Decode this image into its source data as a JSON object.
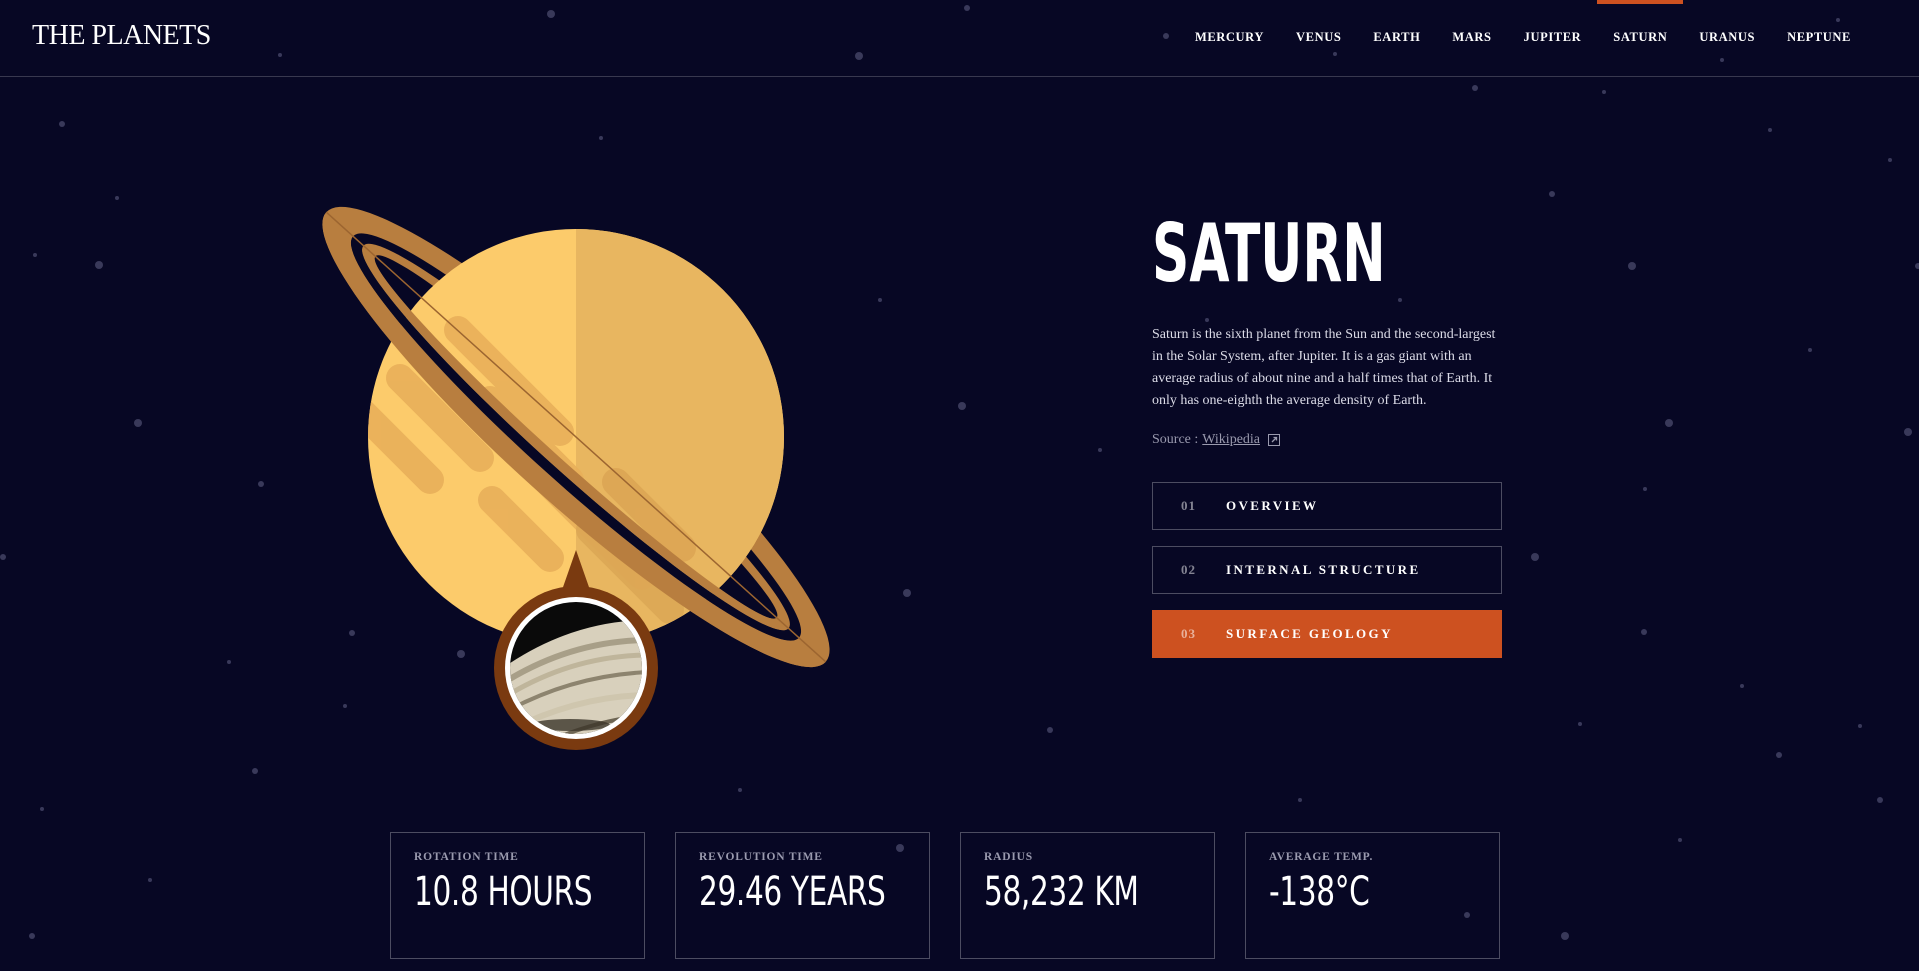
{
  "header": {
    "logo": "THE PLANETS",
    "nav": [
      {
        "label": "MERCURY",
        "active": false
      },
      {
        "label": "VENUS",
        "active": false
      },
      {
        "label": "EARTH",
        "active": false
      },
      {
        "label": "MARS",
        "active": false
      },
      {
        "label": "JUPITER",
        "active": false
      },
      {
        "label": "SATURN",
        "active": true
      },
      {
        "label": "URANUS",
        "active": false
      },
      {
        "label": "NEPTUNE",
        "active": false
      }
    ]
  },
  "planet": {
    "name": "SATURN",
    "description": "Saturn is the sixth planet from the Sun and the second-largest in the Solar System, after Jupiter. It is a gas giant with an average radius of about nine and a half times that of Earth. It only has one-eighth the average density of Earth.",
    "source_label": "Source :",
    "source_link": "Wikipedia",
    "image_icon": "saturn-illustration",
    "geology_icon": "saturn-surface-geology-thumbnail"
  },
  "tabs": [
    {
      "num": "01",
      "label": "OVERVIEW",
      "active": false
    },
    {
      "num": "02",
      "label": "INTERNAL STRUCTURE",
      "active": false
    },
    {
      "num": "03",
      "label": "SURFACE GEOLOGY",
      "active": true
    }
  ],
  "stats": [
    {
      "label": "ROTATION TIME",
      "value": "10.8 HOURS"
    },
    {
      "label": "REVOLUTION TIME",
      "value": "29.46 YEARS"
    },
    {
      "label": "RADIUS",
      "value": "58,232 KM"
    },
    {
      "label": "AVERAGE TEMP.",
      "value": "-138°C"
    }
  ],
  "colors": {
    "background": "#070724",
    "accent": "#CD5120",
    "planet_light": "#FCCB6B",
    "planet_shade": "#E8B660",
    "ring": "#B87E3F"
  }
}
